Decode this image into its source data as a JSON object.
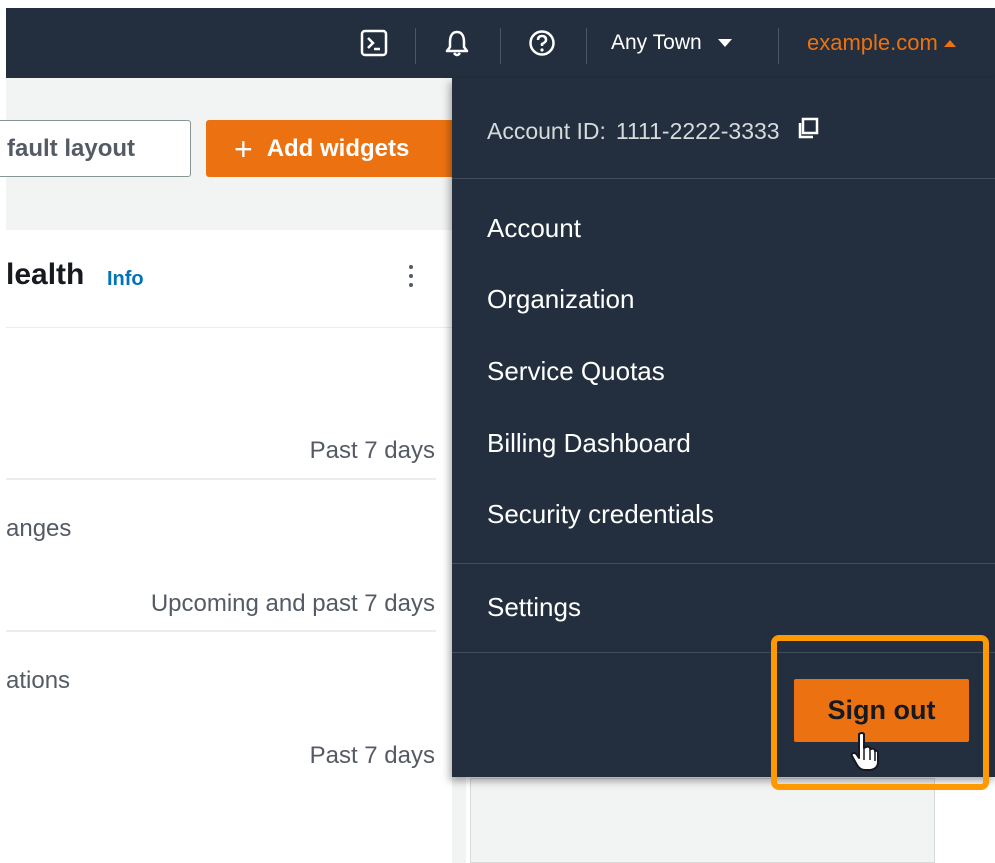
{
  "topbar": {
    "region_label": "Any Town",
    "account_label": "example.com",
    "icons": [
      "cloudshell-icon",
      "bell-icon",
      "help-icon"
    ]
  },
  "page": {
    "layout_button_label": "fault layout",
    "add_widgets_button": {
      "plus": "+",
      "label": "Add widgets"
    },
    "card": {
      "title": "lealth",
      "info_link": "Info",
      "rows": [
        {
          "label": "",
          "right": "Past 7 days"
        },
        {
          "label": "anges",
          "right": "Upcoming and past 7 days"
        },
        {
          "label": "ations",
          "right": "Past 7 days"
        }
      ]
    }
  },
  "dropdown": {
    "account_id_label": "Account ID:",
    "account_id_value": "1111-2222-3333",
    "menu_items": [
      "Account",
      "Organization",
      "Service Quotas",
      "Billing Dashboard",
      "Security credentials"
    ],
    "settings_label": "Settings",
    "sign_out_label": "Sign out"
  },
  "colors": {
    "nav_bg": "#232f3e",
    "accent_orange": "#ec7211",
    "highlight_orange": "#ff9900",
    "link_blue": "#0073bb"
  }
}
